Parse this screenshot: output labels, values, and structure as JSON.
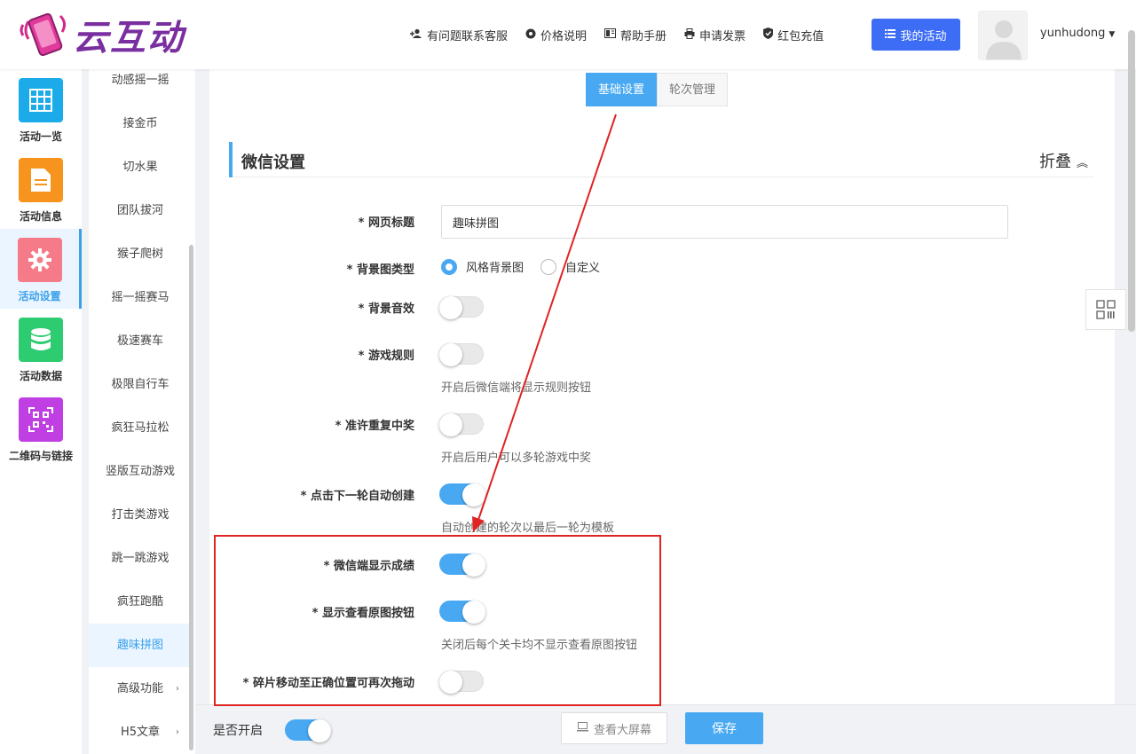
{
  "brand": {
    "name": "云互动"
  },
  "topnav": {
    "items": [
      {
        "label": "有问题联系客服",
        "icon": "add-user-icon"
      },
      {
        "label": "价格说明",
        "icon": "gear-icon"
      },
      {
        "label": "帮助手册",
        "icon": "book-icon"
      },
      {
        "label": "申请发票",
        "icon": "printer-icon"
      },
      {
        "label": "红包充值",
        "icon": "shield-check-icon"
      }
    ],
    "my_activity": "我的活动",
    "username": "yunhudong"
  },
  "rail": {
    "items": [
      {
        "label": "活动一览",
        "color": "#1aabe8"
      },
      {
        "label": "活动信息",
        "color": "#f7941d"
      },
      {
        "label": "活动设置",
        "color": "#f57b89",
        "active": true
      },
      {
        "label": "活动数据",
        "color": "#2ecc71"
      },
      {
        "label": "二维码与链接",
        "color": "#c03fe3"
      }
    ]
  },
  "submenu": {
    "items": [
      "动感摇一摇",
      "接金币",
      "切水果",
      "团队拔河",
      "猴子爬树",
      "摇一摇赛马",
      "极速赛车",
      "极限自行车",
      "疯狂马拉松",
      "竖版互动游戏",
      "打击类游戏",
      "跳一跳游戏",
      "疯狂跑酷",
      "趣味拼图",
      "高级功能",
      "H5文章"
    ],
    "active": "趣味拼图"
  },
  "tabs": [
    "基础设置",
    "轮次管理"
  ],
  "section": {
    "title": "微信设置",
    "fold": "折叠"
  },
  "form": {
    "page_title_label": "* 网页标题",
    "page_title_value": "趣味拼图",
    "bg_type_label": "* 背景图类型",
    "bg_type_options": [
      "风格背景图",
      "自定义"
    ],
    "bg_sound_label": "* 背景音效",
    "rules_label": "* 游戏规则",
    "rules_hint": "开启后微信端将显示规则按钮",
    "repeat_win_label": "* 准许重复中奖",
    "repeat_win_hint": "开启后用户可以多轮游戏中奖",
    "auto_create_label": "* 点击下一轮自动创建",
    "auto_create_hint": "自动创建的轮次以最后一轮为模板",
    "show_score_label": "* 微信端显示成绩",
    "show_original_label": "* 显示查看原图按钮",
    "show_original_hint": "关闭后每个关卡均不显示查看原图按钮",
    "redrag_label": "* 碎片移动至正确位置可再次拖动"
  },
  "toggles": {
    "bg_sound": false,
    "rules": false,
    "repeat_win": false,
    "auto_create": true,
    "show_score": true,
    "show_original": true,
    "redrag": false,
    "enabled": true
  },
  "bottom": {
    "enabled_label": "是否开启",
    "big_screen": "查看大屏幕",
    "save": "保存"
  },
  "colors": {
    "accent": "#48a9f2",
    "primary": "#3d6cf5",
    "annotation": "#e02424"
  }
}
